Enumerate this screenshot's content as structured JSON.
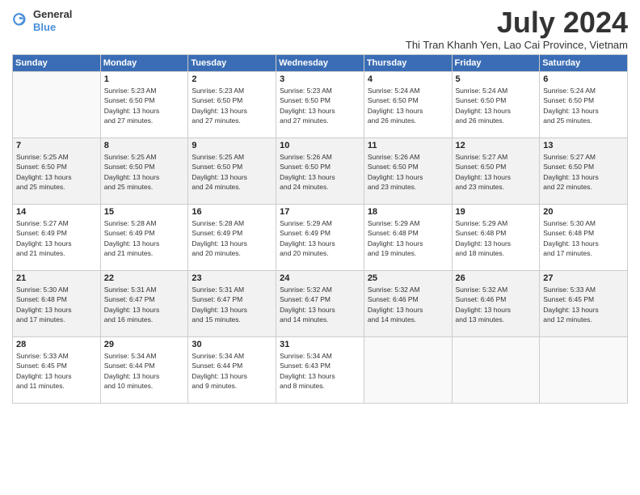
{
  "logo": {
    "line1": "General",
    "line2": "Blue"
  },
  "title": "July 2024",
  "subtitle": "Thi Tran Khanh Yen, Lao Cai Province, Vietnam",
  "days_of_week": [
    "Sunday",
    "Monday",
    "Tuesday",
    "Wednesday",
    "Thursday",
    "Friday",
    "Saturday"
  ],
  "weeks": [
    [
      {
        "day": "",
        "info": ""
      },
      {
        "day": "1",
        "info": "Sunrise: 5:23 AM\nSunset: 6:50 PM\nDaylight: 13 hours\nand 27 minutes."
      },
      {
        "day": "2",
        "info": "Sunrise: 5:23 AM\nSunset: 6:50 PM\nDaylight: 13 hours\nand 27 minutes."
      },
      {
        "day": "3",
        "info": "Sunrise: 5:23 AM\nSunset: 6:50 PM\nDaylight: 13 hours\nand 27 minutes."
      },
      {
        "day": "4",
        "info": "Sunrise: 5:24 AM\nSunset: 6:50 PM\nDaylight: 13 hours\nand 26 minutes."
      },
      {
        "day": "5",
        "info": "Sunrise: 5:24 AM\nSunset: 6:50 PM\nDaylight: 13 hours\nand 26 minutes."
      },
      {
        "day": "6",
        "info": "Sunrise: 5:24 AM\nSunset: 6:50 PM\nDaylight: 13 hours\nand 25 minutes."
      }
    ],
    [
      {
        "day": "7",
        "info": "Sunrise: 5:25 AM\nSunset: 6:50 PM\nDaylight: 13 hours\nand 25 minutes."
      },
      {
        "day": "8",
        "info": "Sunrise: 5:25 AM\nSunset: 6:50 PM\nDaylight: 13 hours\nand 25 minutes."
      },
      {
        "day": "9",
        "info": "Sunrise: 5:25 AM\nSunset: 6:50 PM\nDaylight: 13 hours\nand 24 minutes."
      },
      {
        "day": "10",
        "info": "Sunrise: 5:26 AM\nSunset: 6:50 PM\nDaylight: 13 hours\nand 24 minutes."
      },
      {
        "day": "11",
        "info": "Sunrise: 5:26 AM\nSunset: 6:50 PM\nDaylight: 13 hours\nand 23 minutes."
      },
      {
        "day": "12",
        "info": "Sunrise: 5:27 AM\nSunset: 6:50 PM\nDaylight: 13 hours\nand 23 minutes."
      },
      {
        "day": "13",
        "info": "Sunrise: 5:27 AM\nSunset: 6:50 PM\nDaylight: 13 hours\nand 22 minutes."
      }
    ],
    [
      {
        "day": "14",
        "info": "Sunrise: 5:27 AM\nSunset: 6:49 PM\nDaylight: 13 hours\nand 21 minutes."
      },
      {
        "day": "15",
        "info": "Sunrise: 5:28 AM\nSunset: 6:49 PM\nDaylight: 13 hours\nand 21 minutes."
      },
      {
        "day": "16",
        "info": "Sunrise: 5:28 AM\nSunset: 6:49 PM\nDaylight: 13 hours\nand 20 minutes."
      },
      {
        "day": "17",
        "info": "Sunrise: 5:29 AM\nSunset: 6:49 PM\nDaylight: 13 hours\nand 20 minutes."
      },
      {
        "day": "18",
        "info": "Sunrise: 5:29 AM\nSunset: 6:48 PM\nDaylight: 13 hours\nand 19 minutes."
      },
      {
        "day": "19",
        "info": "Sunrise: 5:29 AM\nSunset: 6:48 PM\nDaylight: 13 hours\nand 18 minutes."
      },
      {
        "day": "20",
        "info": "Sunrise: 5:30 AM\nSunset: 6:48 PM\nDaylight: 13 hours\nand 17 minutes."
      }
    ],
    [
      {
        "day": "21",
        "info": "Sunrise: 5:30 AM\nSunset: 6:48 PM\nDaylight: 13 hours\nand 17 minutes."
      },
      {
        "day": "22",
        "info": "Sunrise: 5:31 AM\nSunset: 6:47 PM\nDaylight: 13 hours\nand 16 minutes."
      },
      {
        "day": "23",
        "info": "Sunrise: 5:31 AM\nSunset: 6:47 PM\nDaylight: 13 hours\nand 15 minutes."
      },
      {
        "day": "24",
        "info": "Sunrise: 5:32 AM\nSunset: 6:47 PM\nDaylight: 13 hours\nand 14 minutes."
      },
      {
        "day": "25",
        "info": "Sunrise: 5:32 AM\nSunset: 6:46 PM\nDaylight: 13 hours\nand 14 minutes."
      },
      {
        "day": "26",
        "info": "Sunrise: 5:32 AM\nSunset: 6:46 PM\nDaylight: 13 hours\nand 13 minutes."
      },
      {
        "day": "27",
        "info": "Sunrise: 5:33 AM\nSunset: 6:45 PM\nDaylight: 13 hours\nand 12 minutes."
      }
    ],
    [
      {
        "day": "28",
        "info": "Sunrise: 5:33 AM\nSunset: 6:45 PM\nDaylight: 13 hours\nand 11 minutes."
      },
      {
        "day": "29",
        "info": "Sunrise: 5:34 AM\nSunset: 6:44 PM\nDaylight: 13 hours\nand 10 minutes."
      },
      {
        "day": "30",
        "info": "Sunrise: 5:34 AM\nSunset: 6:44 PM\nDaylight: 13 hours\nand 9 minutes."
      },
      {
        "day": "31",
        "info": "Sunrise: 5:34 AM\nSunset: 6:43 PM\nDaylight: 13 hours\nand 8 minutes."
      },
      {
        "day": "",
        "info": ""
      },
      {
        "day": "",
        "info": ""
      },
      {
        "day": "",
        "info": ""
      }
    ]
  ]
}
